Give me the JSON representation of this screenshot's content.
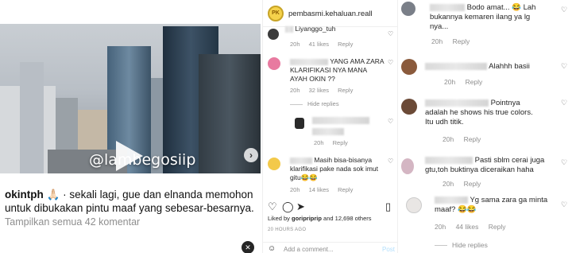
{
  "post": {
    "watermark": "@lambegosiip",
    "caption_user": "okintph",
    "caption_text": "🙏🏻 · sekali lagi, gue dan elnanda memohon untuk dibukakan pintu maaf yang sebesar-besarnya.",
    "show_comments": "Tampilkan semua 42 komentar",
    "next_icon": "chevron-right-icon",
    "mute_icon": "speaker-muted-icon"
  },
  "middle": {
    "account": "pembasmi.kehaluan.reall",
    "comments": [
      {
        "text_end": "Liyanggo_tuh",
        "time": "20h",
        "likes": "41 likes",
        "reply": "Reply"
      },
      {
        "text": "YANG AMA ZARA KLARIFIKASI NYA MANA AYAH OKIN ??",
        "time": "20h",
        "likes": "32 likes",
        "reply": "Reply"
      },
      {
        "time": "20h",
        "reply": "Reply"
      },
      {
        "text": "Masih bisa-bisanya klarifikasi pake nada sok imut gitu😂😂",
        "time": "20h",
        "likes": "14 likes",
        "reply": "Reply"
      }
    ],
    "hide_replies": "Hide replies",
    "liked_by": "Liked by",
    "liked_user": "goripriprip",
    "liked_rest": "and 12,698 others",
    "time_ago": "20 HOURS AGO",
    "add_comment_placeholder": "Add a comment...",
    "post_label": "Post"
  },
  "right": {
    "comments": [
      {
        "line1": "Bodo amat... 😂 Lah",
        "line2": "bukannya kemaren ilang ya lg",
        "line3": "nya...",
        "time": "20h",
        "reply": "Reply"
      },
      {
        "text": "Alahhh basii",
        "time": "20h",
        "reply": "Reply"
      },
      {
        "line1": "Pointnya",
        "line2": "adalah he shows his true colors.",
        "line3": "Itu udh titik.",
        "time": "20h",
        "reply": "Reply"
      },
      {
        "line1": "Pasti sblm cerai juga",
        "line2": "gtu,toh buktinya diceraikan haha",
        "time": "20h",
        "reply": "Reply"
      },
      {
        "line1": "Yg sama zara ga minta",
        "line2": "maaf? 😂😂",
        "time": "20h",
        "likes": "44 likes",
        "reply": "Reply"
      }
    ],
    "hide_replies": "Hide replies"
  }
}
